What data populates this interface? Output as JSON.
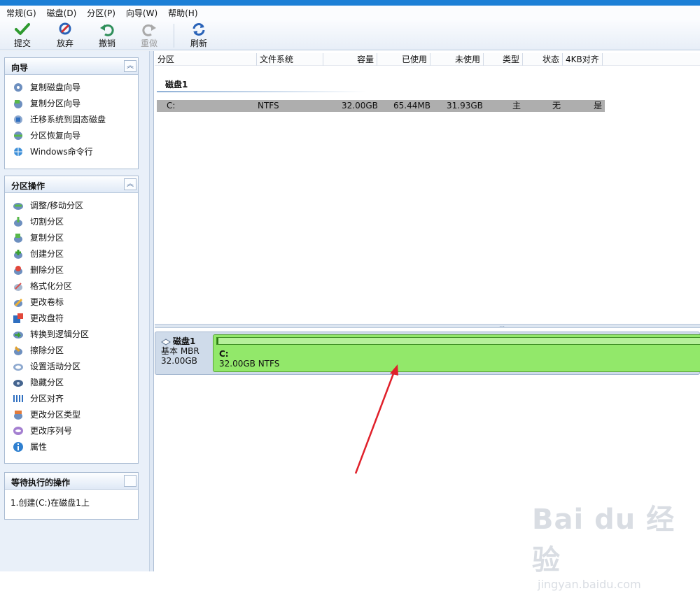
{
  "menubar": {
    "items": [
      "常规(G)",
      "磁盘(D)",
      "分区(P)",
      "向导(W)",
      "帮助(H)"
    ]
  },
  "toolbar": {
    "buttons": [
      {
        "label": "提交",
        "icon": "check-icon",
        "enabled": true
      },
      {
        "label": "放弃",
        "icon": "discard-icon",
        "enabled": true
      },
      {
        "label": "撤销",
        "icon": "undo-icon",
        "enabled": true
      },
      {
        "label": "重做",
        "icon": "redo-icon",
        "enabled": false
      },
      {
        "label": "刷新",
        "icon": "refresh-icon",
        "enabled": true
      }
    ]
  },
  "wizard_panel": {
    "title": "向导",
    "items": [
      {
        "label": "复制磁盘向导",
        "icon": "copy-disk-icon"
      },
      {
        "label": "复制分区向导",
        "icon": "copy-partition-icon"
      },
      {
        "label": "迁移系统到固态磁盘",
        "icon": "migrate-os-icon"
      },
      {
        "label": "分区恢复向导",
        "icon": "partition-recovery-icon"
      },
      {
        "label": "Windows命令行",
        "icon": "globe-icon"
      }
    ]
  },
  "partition_ops_panel": {
    "title": "分区操作",
    "items": [
      {
        "label": "调整/移动分区",
        "icon": "resize-icon"
      },
      {
        "label": "切割分区",
        "icon": "split-icon"
      },
      {
        "label": "复制分区",
        "icon": "copy-icon"
      },
      {
        "label": "创建分区",
        "icon": "create-icon"
      },
      {
        "label": "删除分区",
        "icon": "delete-icon"
      },
      {
        "label": "格式化分区",
        "icon": "format-icon"
      },
      {
        "label": "更改卷标",
        "icon": "label-icon"
      },
      {
        "label": "更改盘符",
        "icon": "drive-letter-icon"
      },
      {
        "label": "转换到逻辑分区",
        "icon": "convert-icon"
      },
      {
        "label": "擦除分区",
        "icon": "wipe-icon"
      },
      {
        "label": "设置活动分区",
        "icon": "set-active-icon"
      },
      {
        "label": "隐藏分区",
        "icon": "hide-icon"
      },
      {
        "label": "分区对齐",
        "icon": "align-icon"
      },
      {
        "label": "更改分区类型",
        "icon": "change-type-icon"
      },
      {
        "label": "更改序列号",
        "icon": "serial-icon"
      },
      {
        "label": "属性",
        "icon": "info-icon"
      }
    ]
  },
  "pending_panel": {
    "title": "等待执行的操作",
    "items": [
      "1.创建(C:)在磁盘1上"
    ]
  },
  "partition_table": {
    "columns": [
      "分区",
      "文件系统",
      "容量",
      "已使用",
      "未使用",
      "类型",
      "状态",
      "4KB对齐"
    ],
    "disk_label": "磁盘1",
    "rows": [
      {
        "partition": "C:",
        "filesystem": "NTFS",
        "capacity": "32.00GB",
        "used": "65.44MB",
        "unused": "31.93GB",
        "type": "主",
        "status": "无",
        "aligned": "是"
      }
    ]
  },
  "disk_map": {
    "disk_name": "磁盘1",
    "disk_type": "基本 MBR",
    "disk_size": "32.00GB",
    "partition_name": "C:",
    "partition_desc": "32.00GB NTFS",
    "used_fraction": 0.002
  },
  "annotation": {
    "arrow_color": "#e0202a"
  },
  "watermark": {
    "brand": "Bai du 经验",
    "url": "jingyan.baidu.com"
  },
  "colors": {
    "partition_fill": "#92e86a",
    "selected_row": "#aeaeae",
    "titlebar": "#1c7fd6"
  }
}
